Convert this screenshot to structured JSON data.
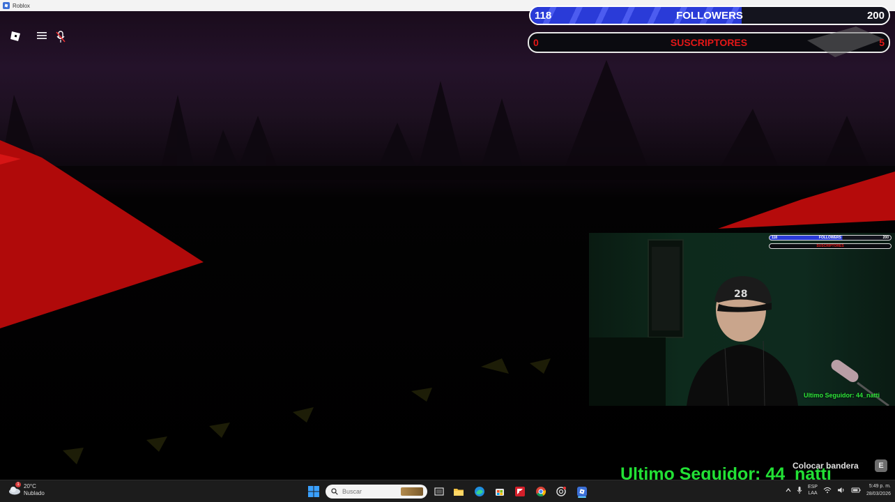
{
  "window": {
    "title": "Roblox"
  },
  "overlay": {
    "followers": {
      "current": "118",
      "label": "FOLLOWERS",
      "goal": "200",
      "progress": 0.59,
      "color": "#2a3bd8"
    },
    "subscribers": {
      "current": "0",
      "label": "SUSCRIPTORES",
      "goal": "5",
      "color": "#e51717"
    },
    "last_follower": "Ultimo Seguidor: 44_natti",
    "webcam_last_follower": "Ultimo Seguidor: 44_natti",
    "mini_followers": {
      "current": "118",
      "label": "FOLLOWERS",
      "goal": "200"
    },
    "mini_subscribers": {
      "label": "SUSCRIPTORES"
    }
  },
  "game": {
    "controls": [
      {
        "name": "roblox-menu-icon"
      },
      {
        "name": "hamburger-menu-icon"
      },
      {
        "name": "microphone-muted-icon"
      }
    ],
    "prompt": {
      "action": "Colocar bandera",
      "key": "E"
    }
  },
  "taskbar": {
    "weather": {
      "temp": "20°C",
      "condition": "Nublado",
      "badge": "1"
    },
    "search_placeholder": "Buscar",
    "apps": [
      "windows-start-icon",
      "task-view-icon",
      "file-explorer-icon",
      "edge-icon",
      "store-icon",
      "amd-icon",
      "chrome-icon",
      "openai-icon",
      "roblox-icon"
    ],
    "tray": {
      "lang_top": "ESP",
      "lang_bottom": "LAA",
      "time": "5:49 p. m.",
      "date": "28/03/2026"
    }
  }
}
